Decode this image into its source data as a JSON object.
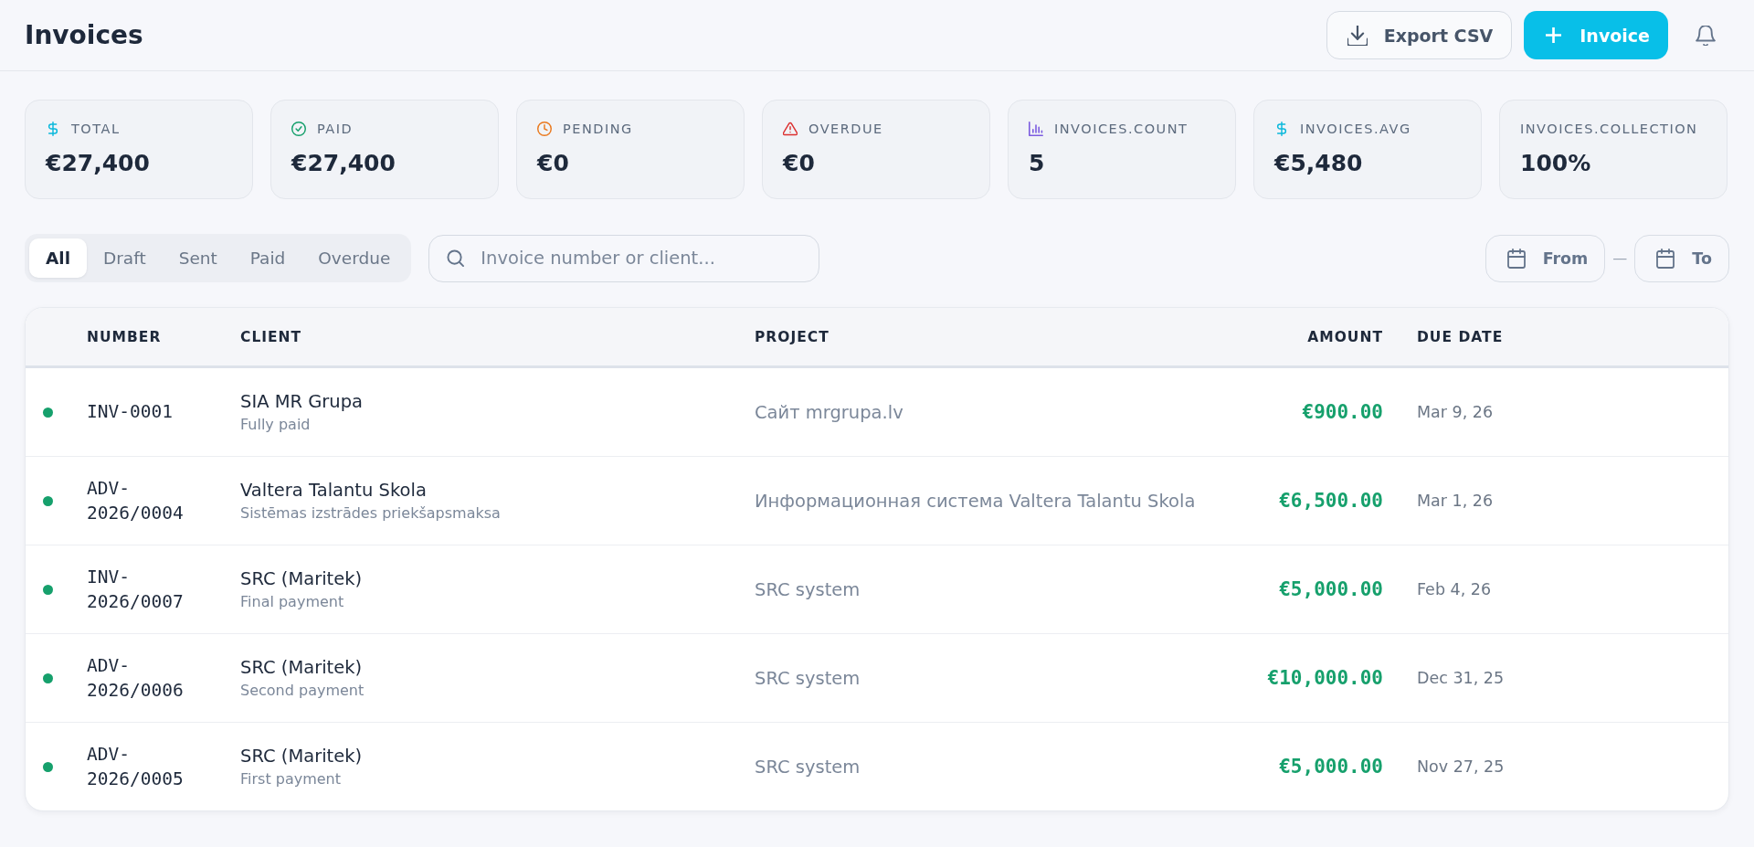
{
  "header": {
    "title": "Invoices",
    "export_button": "Export CSV",
    "new_button": "Invoice"
  },
  "stats": [
    {
      "kind": "total",
      "label": "TOTAL",
      "value": "€27,400"
    },
    {
      "kind": "paid",
      "label": "PAID",
      "value": "€27,400"
    },
    {
      "kind": "pending",
      "label": "PENDING",
      "value": "€0"
    },
    {
      "kind": "overdue",
      "label": "OVERDUE",
      "value": "€0"
    },
    {
      "kind": "count",
      "label": "INVOICES.COUNT",
      "value": "5"
    },
    {
      "kind": "avg",
      "label": "INVOICES.AVG",
      "value": "€5,480"
    },
    {
      "kind": "collection",
      "label": "INVOICES.COLLECTION",
      "value": "100%"
    }
  ],
  "filters": {
    "tabs": [
      {
        "label": "All",
        "selected": true
      },
      {
        "label": "Draft",
        "selected": false
      },
      {
        "label": "Sent",
        "selected": false
      },
      {
        "label": "Paid",
        "selected": false
      },
      {
        "label": "Overdue",
        "selected": false
      }
    ],
    "search": {
      "placeholder": "Invoice number or client..."
    },
    "date_from": "From",
    "date_separator": "—",
    "date_to": "To"
  },
  "table": {
    "columns": [
      "NUMBER",
      "CLIENT",
      "PROJECT",
      "AMOUNT",
      "DUE DATE"
    ],
    "rows": [
      {
        "color": "#16a06c",
        "number": "INV-0001",
        "client": "SIA MR Grupa",
        "note": "Fully paid",
        "project": "Сайт mrgrupa.lv",
        "amount": "€900.00",
        "due_date": "Mar 9, 26"
      },
      {
        "color": "#16a06c",
        "number": "ADV-2026/0004",
        "client": "Valtera Talantu Skola",
        "note": "Sistēmas izstrādes priekšapsmaksa",
        "project": "Информационная система Valtera Talantu Skola",
        "amount": "€6,500.00",
        "due_date": "Mar 1, 26"
      },
      {
        "color": "#16a06c",
        "number": "INV-2026/0007",
        "client": "SRC (Maritek)",
        "note": "Final payment",
        "project": "SRC system",
        "amount": "€5,000.00",
        "due_date": "Feb 4, 26"
      },
      {
        "color": "#16a06c",
        "number": "ADV-2026/0006",
        "client": "SRC (Maritek)",
        "note": "Second payment",
        "project": "SRC system",
        "amount": "€10,000.00",
        "due_date": "Dec 31, 25"
      },
      {
        "color": "#16a06c",
        "number": "ADV-2026/0005",
        "client": "SRC (Maritek)",
        "note": "First payment",
        "project": "SRC system",
        "amount": "€5,000.00",
        "due_date": "Nov 27, 25"
      }
    ]
  }
}
